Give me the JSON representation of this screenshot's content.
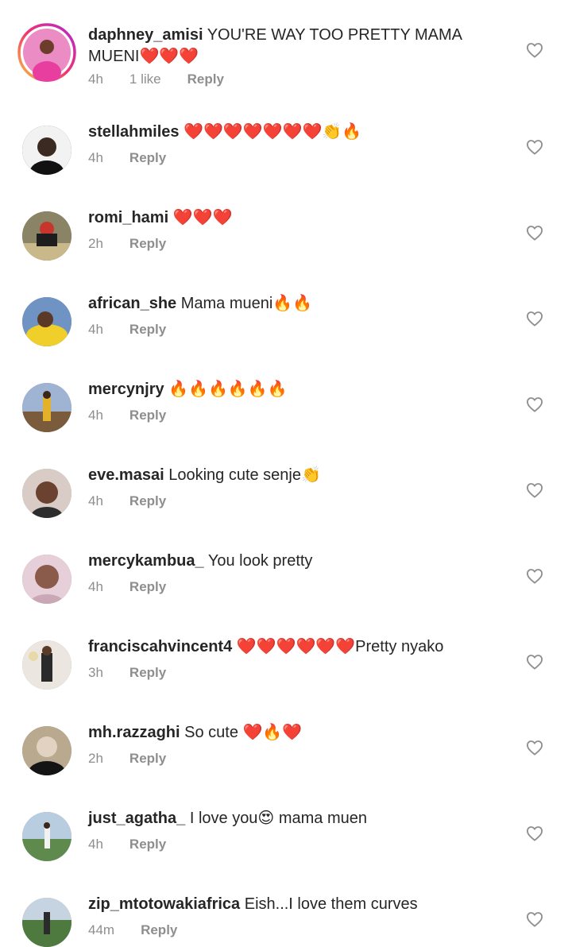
{
  "comments": [
    {
      "username": "daphney_amisi",
      "text": "YOU'RE WAY TOO PRETTY MAMA MUENI❤️❤️❤️",
      "time": "4h",
      "likes": "1 like",
      "reply": "Reply",
      "avatar_color": "#e14fa7"
    },
    {
      "username": "stellahmiles",
      "text": "❤️❤️❤️❤️❤️❤️❤️👏🔥",
      "time": "4h",
      "likes": "",
      "reply": "Reply",
      "avatar_color": "#3a2a22"
    },
    {
      "username": "romi_hami",
      "text": "❤️❤️❤️",
      "time": "2h",
      "likes": "",
      "reply": "Reply",
      "avatar_color": "#6f6a55"
    },
    {
      "username": "african_she",
      "text": "Mama mueni🔥🔥",
      "time": "4h",
      "likes": "",
      "reply": "Reply",
      "avatar_color": "#e5c12d"
    },
    {
      "username": "mercynjry",
      "text": "🔥🔥🔥🔥🔥🔥",
      "time": "4h",
      "likes": "",
      "reply": "Reply",
      "avatar_color": "#8aa0c6"
    },
    {
      "username": "eve.masai",
      "text": "Looking cute senje👏",
      "time": "4h",
      "likes": "",
      "reply": "Reply",
      "avatar_color": "#b79a8c"
    },
    {
      "username": "mercykambua_",
      "text": "You look pretty",
      "time": "4h",
      "likes": "",
      "reply": "Reply",
      "avatar_color": "#caa7b4"
    },
    {
      "username": "franciscahvincent4",
      "text": "❤️❤️❤️❤️❤️❤️Pretty nyako",
      "time": "3h",
      "likes": "",
      "reply": "Reply",
      "avatar_color": "#d8d2c8"
    },
    {
      "username": "mh.razzaghi",
      "text": "So cute ❤️🔥❤️",
      "time": "2h",
      "likes": "",
      "reply": "Reply",
      "avatar_color": "#4d4a45"
    },
    {
      "username": "just_agatha_",
      "text": "I love you😍 mama muen",
      "time": "4h",
      "likes": "",
      "reply": "Reply",
      "avatar_color": "#7da07a"
    },
    {
      "username": "zip_mtotowakiafrica",
      "text": "Eish...I love them curves",
      "time": "44m",
      "likes": "",
      "reply": "Reply",
      "avatar_color": "#6e8f5e"
    }
  ],
  "icons": {
    "like": "heart-outline-icon",
    "story_ring": "gradient-ring"
  },
  "colors": {
    "text": "#262626",
    "meta": "#8e8e8e",
    "ring_start": "#f9c23c",
    "ring_end": "#d300c5"
  }
}
